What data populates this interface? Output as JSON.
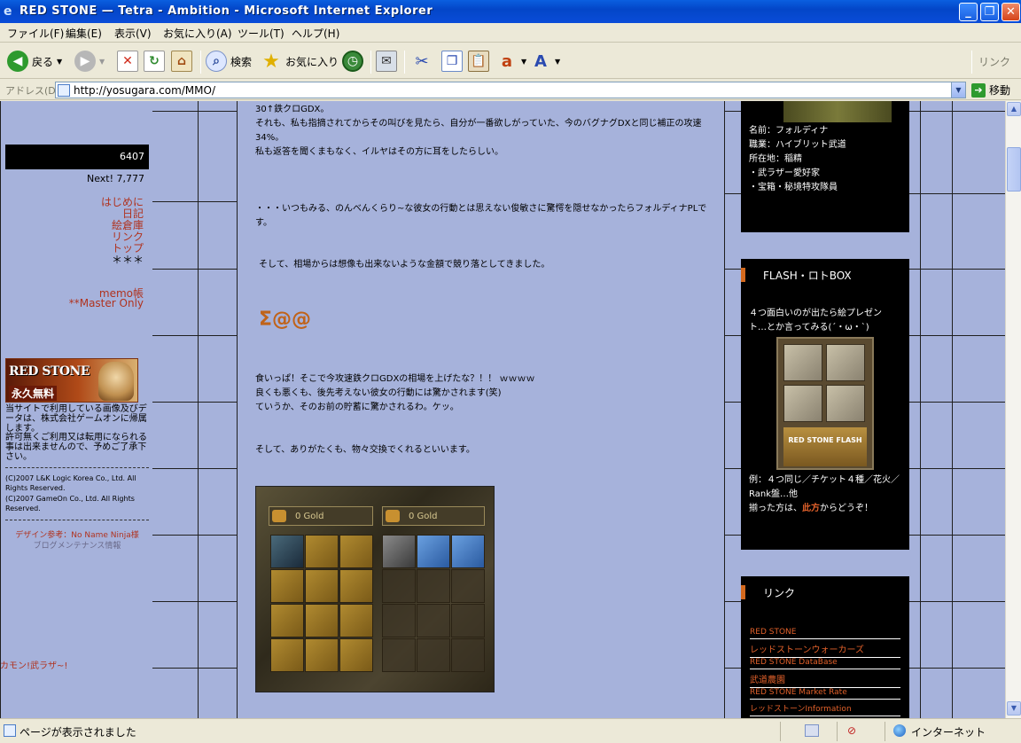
{
  "window": {
    "title": "RED STONE — Tetra - Ambition - Microsoft Internet Explorer"
  },
  "menu": [
    "ファイル(F)",
    "編集(E)",
    "表示(V)",
    "お気に入り(A)",
    "ツール(T)",
    "ヘルプ(H)"
  ],
  "toolbar": {
    "back": "戻る",
    "search": "検索",
    "favorites": "お気に入り",
    "links": "リンク"
  },
  "address": {
    "label": "アドレス(D)",
    "url": "http://yosugara.com/MMO/",
    "go": "移動"
  },
  "sidebar": {
    "counter": "6407",
    "next": "Next! 7,777",
    "nav": [
      "はじめに",
      "日記",
      "絵倉庫",
      "リンク",
      "トップ",
      "＊＊＊"
    ],
    "memo": "memo帳",
    "master": "**Master Only",
    "banner_title": "RED STONE",
    "banner_sub": "永久無料",
    "notice": "当サイトで利用している画像及びデータは、株式会社ゲームオンに帰属します。",
    "notice2": "許可無くご利用又は転用になられる事は出来ませんので、予めご了承下さい。",
    "copy1": "(C)2007 L&K Logic Korea Co., Ltd. All Rights Reserved.",
    "copy2": "(C)2007 GameOn Co., Ltd. All Rights Reserved.",
    "design": "デザイン参考：No Name Ninja様",
    "blog": "ブログメンテナンス情報",
    "bottom": "カモン!武ラザ~!"
  },
  "post": {
    "p1": "30↑鉄クロGDX。",
    "p2": "それも、私も指摘されてからその叫びを見たら、自分が一番欲しがっていた、今のバグナグDXと同じ補正の攻速34%。",
    "p3": "私も返答を聞くまもなく、イルヤはその方に耳をしたらしい。",
    "p4": "・・・いつもみる、のんべんくらり~な彼女の行動とは思えない俊敏さに驚愕を隠せなかったらフォルディナPLです。",
    "p5": "そして、相場からは想像も出来ないような金額で競り落としてきました。",
    "sigma": "Σ@@",
    "p6": "食いっぱ！そこで今攻速鉄クロGDXの相場を上げたな？！！ ｗｗｗｗ",
    "p7": "良くも悪くも、後先考えない彼女の行動には驚かされます(笑)",
    "p8": "ていうか、そのお前の貯蓄に驚かされるわ。ケッ。",
    "p9": "そして、ありがたくも、物々交換でくれるといいます。",
    "gold_left": "0 Gold",
    "gold_right": "0 Gold"
  },
  "profile": {
    "lines": [
      "名前：フォルディナ",
      "職業：ハイブリット武道",
      "所在地：稲精",
      "・武ラザー愛好家",
      "・宝箱・秘境特攻隊員"
    ]
  },
  "flash_box": {
    "title": "FLASH・ロトBOX",
    "line1": "４つ面白いのが出たら絵プレゼン",
    "line2": "ト…とか言ってみる(´・ω・`)",
    "card_text": "RED STONE FLASH",
    "line3": "例：４つ同じ／チケット４種／花火／",
    "line4": "Rank盤…他",
    "line5_pre": "揃った方は、",
    "line5_link": "此方",
    "line5_post": "からどうぞ！"
  },
  "links_box": {
    "title": "リンク",
    "items": [
      "RED STONE",
      "レッドストーンウォーカーズ",
      "RED STONE DataBase",
      "武道農園",
      "RED STONE Market Rate",
      "レッドストーンInformation"
    ]
  },
  "status": {
    "message": "ページが表示されました",
    "zone": "インターネット"
  }
}
